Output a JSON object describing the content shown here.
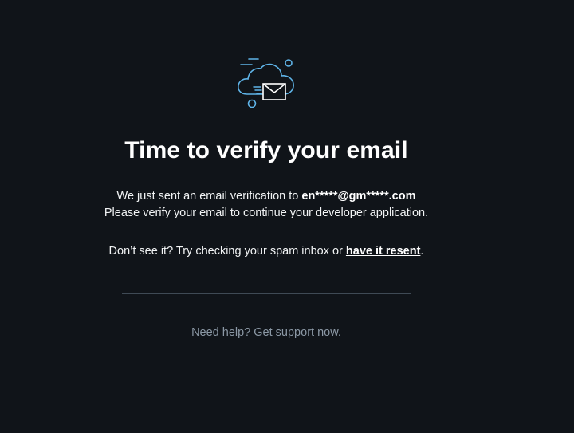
{
  "icon": "cloud-mail-icon",
  "colors": {
    "background": "#101419",
    "accent": "#5fb4e8",
    "muted": "#8b98a5",
    "divider": "#3f4a55"
  },
  "verify": {
    "title": "Time to verify your email",
    "sent_text": "We just sent an email verification to ",
    "email": "en*****@gm*****.com",
    "continue_text": "Please verify your email to continue your developer application.",
    "spam_text": "Don’t see it? Try checking your spam inbox or ",
    "resend_link": "have it resent",
    "spam_suffix": "."
  },
  "help": {
    "prefix": "Need help? ",
    "link": "Get support now",
    "suffix": "."
  }
}
